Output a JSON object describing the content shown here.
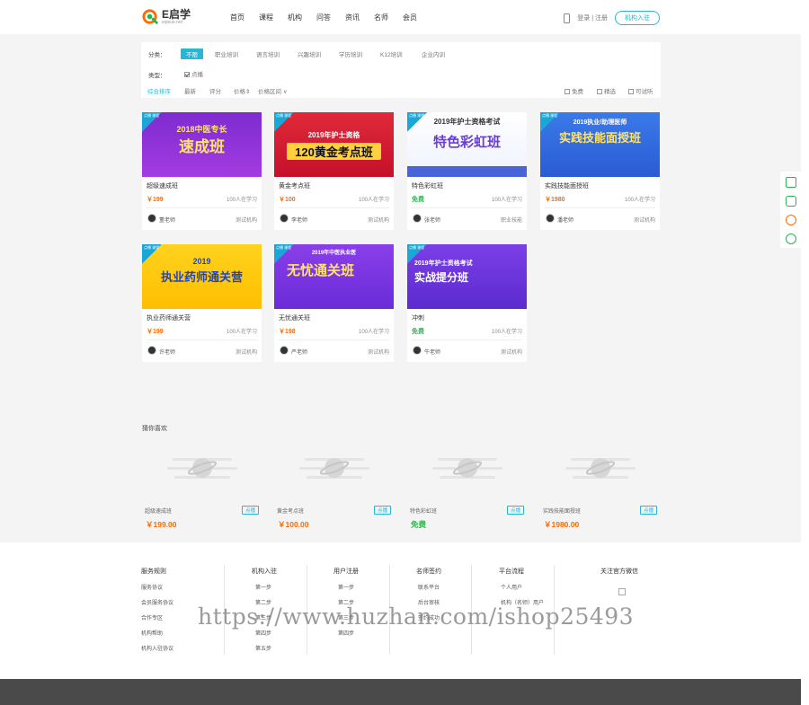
{
  "header": {
    "logo_title": "E启学",
    "logo_sub": "eqixue.net",
    "nav": [
      "首页",
      "课程",
      "机构",
      "问答",
      "资讯",
      "名师",
      "会员"
    ],
    "login": "登录 | 注册",
    "join_button": "机构入驻",
    "accent_color": "#26b7d6"
  },
  "filter": {
    "category_label": "分类：",
    "categories": [
      "不限",
      "职业培训",
      "语言培训",
      "兴趣培训",
      "学历培训",
      "K12培训",
      "企业内训"
    ],
    "type_label": "类型：",
    "type_option": "点播",
    "sort": [
      "综合排序",
      "最新",
      "评分",
      "价格",
      "价格区间"
    ],
    "price_arrow": "⇕",
    "range_arrow": "∨",
    "flags": [
      "免费",
      "精选",
      "可试听"
    ]
  },
  "courses": [
    {
      "title": "超级速成班",
      "price": "￥199",
      "learners": "100人在学习",
      "teacher": "董老师",
      "org": "测试机构",
      "badge": "点播 课程",
      "img_line1": "2018中医专长",
      "img_line2": "速成班"
    },
    {
      "title": "黄金考点班",
      "price": "￥100",
      "learners": "100人在学习",
      "teacher": "李老师",
      "org": "测试机构",
      "badge": "点播 课程",
      "img_line1": "2019年护士资格",
      "img_line2": "120黄金考点班"
    },
    {
      "title": "特色彩虹班",
      "price": "免费",
      "learners": "100人在学习",
      "teacher": "张老师",
      "org": "职业技能",
      "badge": "点播 课程",
      "img_line1": "2019年护士资格考试",
      "img_line2": "特色彩虹班"
    },
    {
      "title": "实践技能面授班",
      "price": "￥1980",
      "learners": "100人在学习",
      "teacher": "潘老师",
      "org": "测试机构",
      "badge": "点播 课程",
      "img_line1": "2019执业/助理医师",
      "img_line2": "实践技能面授班"
    },
    {
      "title": "执业药师通关营",
      "price": "￥199",
      "learners": "100人在学习",
      "teacher": "许老师",
      "org": "测试机构",
      "badge": "点播 课程",
      "img_line1": "2019",
      "img_line2": "执业药师通关营"
    },
    {
      "title": "无忧通关班",
      "price": "￥198",
      "learners": "100人在学习",
      "teacher": "严老师",
      "org": "测试机构",
      "badge": "点播 课程",
      "img_line1": "2019年中医执业医",
      "img_line2": "无忧通关班"
    },
    {
      "title": "冲刺",
      "price": "免费",
      "learners": "100人在学习",
      "teacher": "牛老师",
      "org": "测试机构",
      "badge": "点播 课程",
      "img_line1": "2019年护士资格考试",
      "img_line2": "实战提分班"
    }
  ],
  "guess": {
    "title": "猜你喜欢",
    "items": [
      {
        "name": "超级速成班",
        "tag": "点播",
        "price": "￥199.00"
      },
      {
        "name": "黄金考点班",
        "tag": "点播",
        "price": "￥100.00"
      },
      {
        "name": "特色彩虹班",
        "tag": "点播",
        "price": "免费"
      },
      {
        "name": "实践技能面授班",
        "tag": "点播",
        "price": "￥1980.00"
      }
    ]
  },
  "footer": {
    "columns": [
      {
        "title": "服务规则",
        "items": [
          "服务协议",
          "会员服务协议",
          "合作专区",
          "机构帮助",
          "机构入驻协议"
        ]
      },
      {
        "title": "机构入驻",
        "items": [
          "第一步",
          "第二步",
          "第三步",
          "第四步",
          "第五步"
        ]
      },
      {
        "title": "用户注册",
        "items": [
          "第一步",
          "第二步",
          "第三步",
          "第四步"
        ]
      },
      {
        "title": "名师签约",
        "items": [
          "联系平台",
          "后台审核",
          "签约成功"
        ]
      },
      {
        "title": "平台流程",
        "items": [
          "个人用户",
          "机构（名师）用户"
        ]
      }
    ],
    "wechat_title": "关注官方微信"
  },
  "watermark": "https://www.huzhan.com/ishop25493"
}
